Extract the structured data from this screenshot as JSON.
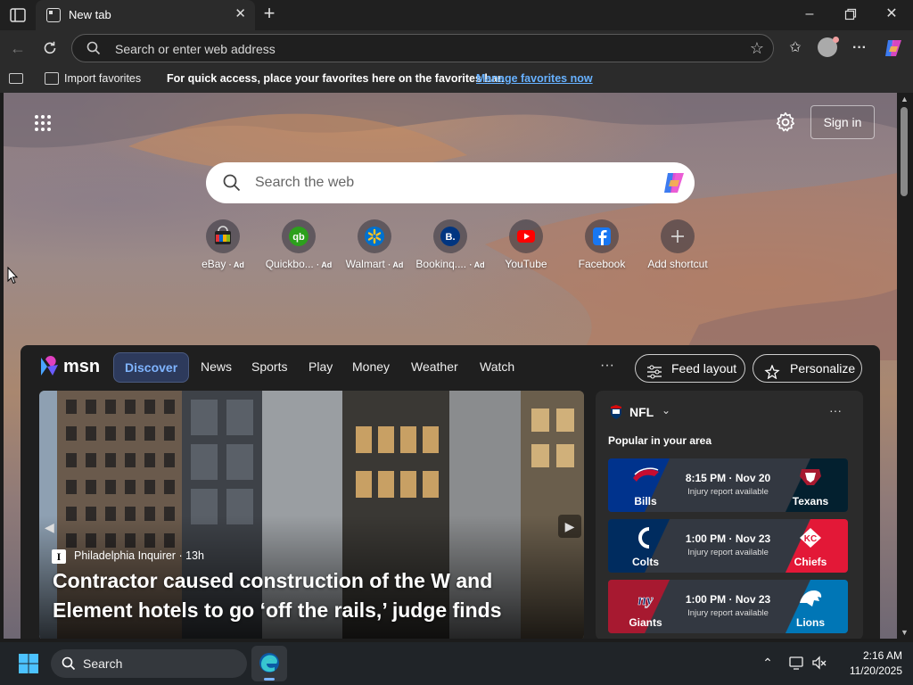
{
  "browser": {
    "tab_title": "New tab",
    "address_placeholder": "Search or enter web address"
  },
  "favorites_bar": {
    "import_label": "Import favorites",
    "message": "For quick access, place your favorites here on the favorites bar.",
    "manage_link": "Manage favorites now"
  },
  "newtab": {
    "sign_in_label": "Sign in",
    "search_placeholder": "Search the web",
    "shortcuts": [
      {
        "label": "eBay",
        "ad": "· Ad",
        "icon": "ebay-icon"
      },
      {
        "label": "Quickbo...",
        "ad": "· Ad",
        "icon": "quickbooks-icon"
      },
      {
        "label": "Walmart",
        "ad": "· Ad",
        "icon": "walmart-icon"
      },
      {
        "label": "Bookinq....",
        "ad": "· Ad",
        "icon": "booking-icon"
      },
      {
        "label": "YouTube",
        "ad": "",
        "icon": "youtube-icon"
      },
      {
        "label": "Facebook",
        "ad": "",
        "icon": "facebook-icon"
      },
      {
        "label": "Add shortcut",
        "ad": "",
        "icon": "plus-icon"
      }
    ]
  },
  "feed": {
    "logo_text": "msn",
    "tabs": [
      "Discover",
      "News",
      "Sports",
      "Play",
      "Money",
      "Weather",
      "Watch"
    ],
    "more": "···",
    "feed_layout_label": "Feed layout",
    "personalize_label": "Personalize",
    "hero": {
      "source_icon": "I",
      "source": "Philadelphia Inquirer · 13h",
      "headline": "Contractor caused construction of the W and Element hotels to go ‘off the rails,’ judge finds"
    },
    "nfl": {
      "title": "NFL",
      "more": "···",
      "subtitle": "Popular in your area",
      "games": [
        {
          "home": "Bills",
          "away": "Texans",
          "time": "8:15 PM · Nov 20",
          "note": "Injury report available",
          "left_color": "#00338d",
          "right_color": "#03202f"
        },
        {
          "home": "Colts",
          "away": "Chiefs",
          "time": "1:00 PM · Nov 23",
          "note": "Injury report available",
          "left_color": "#002c5f",
          "right_color": "#e31837"
        },
        {
          "home": "Giants",
          "away": "Lions",
          "time": "1:00 PM · Nov 23",
          "note": "Injury report available",
          "left_color": "#a71930",
          "right_color": "#0076b6"
        }
      ]
    }
  },
  "taskbar": {
    "search_label": "Search",
    "time": "2:16 AM",
    "date": "11/20/2025"
  },
  "colors": {
    "accent_link": "#67b1ff",
    "feed_active_tab": "#7fb4ff"
  }
}
